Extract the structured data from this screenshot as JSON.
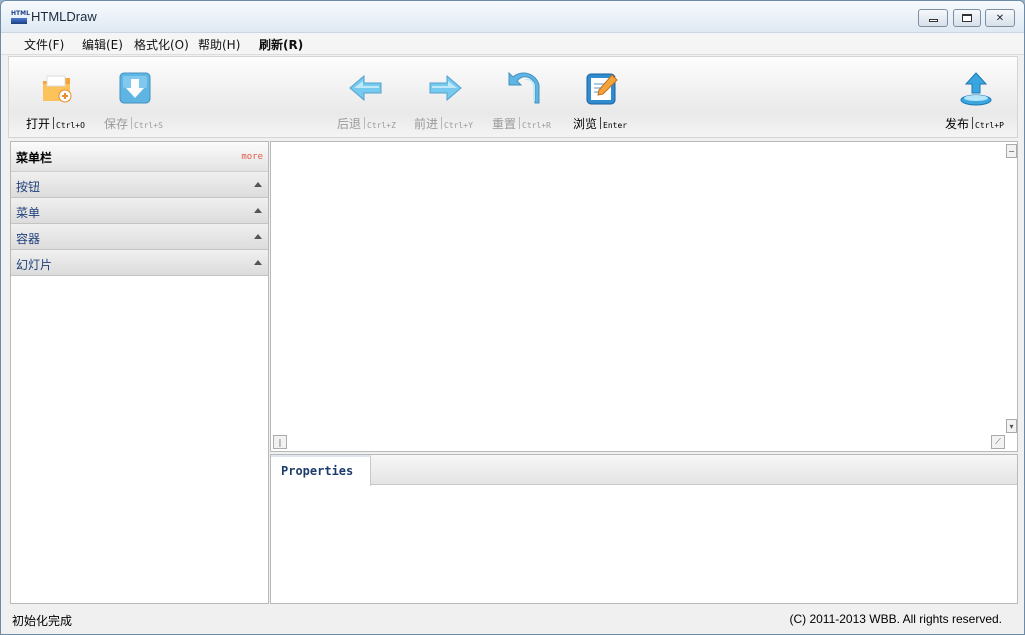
{
  "window": {
    "title": "HTMLDraw",
    "icon_text": "HTML"
  },
  "menu": [
    {
      "label": "文件(F)",
      "bold": false
    },
    {
      "label": "编辑(E)",
      "bold": false
    },
    {
      "label": "格式化(O)",
      "bold": false
    },
    {
      "label": "帮助(H)",
      "bold": false
    },
    {
      "label": "刷新(R)",
      "bold": true
    }
  ],
  "toolbar": {
    "open": {
      "label": "打开",
      "shortcut": "Ctrl+O",
      "icon": "folder-icon",
      "enabled": true
    },
    "save": {
      "label": "保存",
      "shortcut": "Ctrl+S",
      "icon": "save-download-icon",
      "enabled": false
    },
    "back": {
      "label": "后退",
      "shortcut": "Ctrl+Z",
      "icon": "arrow-left-icon",
      "enabled": false
    },
    "forward": {
      "label": "前进",
      "shortcut": "Ctrl+Y",
      "icon": "arrow-right-icon",
      "enabled": false
    },
    "reset": {
      "label": "重置",
      "shortcut": "Ctrl+R",
      "icon": "undo-reset-icon",
      "enabled": false
    },
    "browse": {
      "label": "浏览",
      "shortcut": "Enter",
      "icon": "notepad-pencil-icon",
      "enabled": true
    },
    "publish": {
      "label": "发布",
      "shortcut": "Ctrl+P",
      "icon": "upload-icon",
      "enabled": true
    }
  },
  "left_panel": {
    "title": "菜单栏",
    "more": "more",
    "sections": [
      "按钮",
      "菜单",
      "容器",
      "幻灯片"
    ]
  },
  "properties": {
    "tab_label": "Properties"
  },
  "status": {
    "left": "初始化完成",
    "right": "(C) 2011-2013 WBB. All rights reserved."
  },
  "colors": {
    "accent_blue": "#1f3f7a",
    "more_link": "#e05a4a",
    "titlebar": "#dfe9f3"
  }
}
